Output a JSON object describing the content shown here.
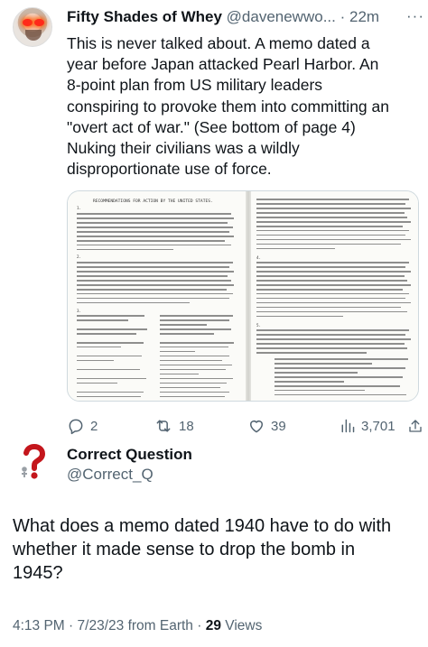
{
  "tweet1": {
    "author_name": "Fifty Shades of Whey",
    "handle": "@davenewwo...",
    "separator": "·",
    "time": "22m",
    "more": "···",
    "text_lines": [
      "This is never talked about. A memo dated a",
      "year before Japan attacked Pearl Harbor. An",
      "8-point plan from US military leaders",
      "conspiring to provoke them into committing an",
      "\"overt act of war.\" (See bottom of page 4)",
      "Nuking their civilians was a wildly",
      "disproportionate use of force."
    ],
    "memo_title": "RECOMMENDATIONS FOR ACTION BY THE UNITED STATES.",
    "memo_numbers": [
      "1.",
      "2.",
      "3.",
      "4.",
      "5."
    ],
    "actions": {
      "replies": "2",
      "reposts": "18",
      "likes": "39",
      "views": "3,701"
    }
  },
  "tweet2": {
    "author_name": "Correct Question",
    "handle": "@Correct_Q",
    "text_lines": [
      "What does a memo dated 1940 have to do with",
      "whether it made sense to drop the bomb in",
      "1945?"
    ],
    "time": "4:13 PM",
    "date": "7/23/23",
    "source": "from Earth",
    "separator": "·",
    "views_count": "29",
    "views_label": "Views"
  },
  "colors": {
    "text": "#0f1419",
    "secondary": "#536471",
    "border": "#cfd9de",
    "avatar_eyes": "#ff2a1a",
    "question_mark": "#c4161c"
  }
}
